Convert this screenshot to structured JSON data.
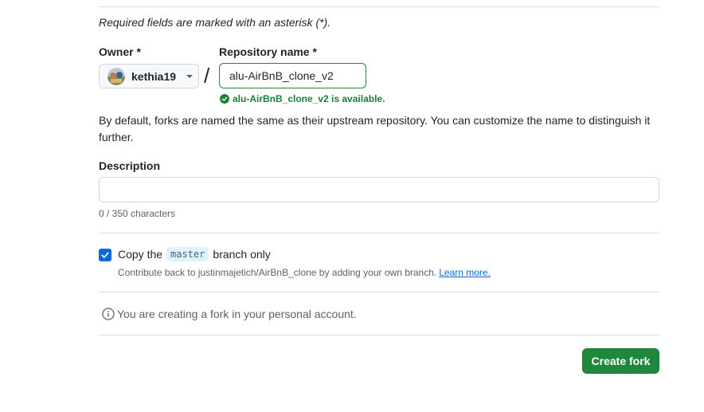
{
  "form": {
    "required_note": "Required fields are marked with an asterisk (*).",
    "owner_label": "Owner *",
    "owner_value": "kethia19",
    "repo_label": "Repository name *",
    "repo_value": "alu-AirBnB_clone_v2",
    "availability": "alu-AirBnB_clone_v2 is available.",
    "naming_help": "By default, forks are named the same as their upstream repository. You can customize the name to distinguish it further.",
    "description_label": "Description",
    "description_value": "",
    "char_count": "0 / 350 characters",
    "copy_prefix": "Copy the",
    "copy_branch": "master",
    "copy_suffix": "branch only",
    "copy_checked": true,
    "contribute_text": "Contribute back to justinmajetich/AirBnB_clone by adding your own branch.",
    "learn_more": "Learn more.",
    "fork_info": "You are creating a fork in your personal account.",
    "create_button": "Create fork"
  },
  "colors": {
    "accent_green": "#1f883d",
    "success_text": "#1a7f37",
    "checkbox_blue": "#0969da",
    "border": "#d0d7de"
  },
  "icons": {
    "availability": "check-circle-fill-icon",
    "info": "info-icon",
    "owner_dropdown": "caret-down-icon"
  }
}
